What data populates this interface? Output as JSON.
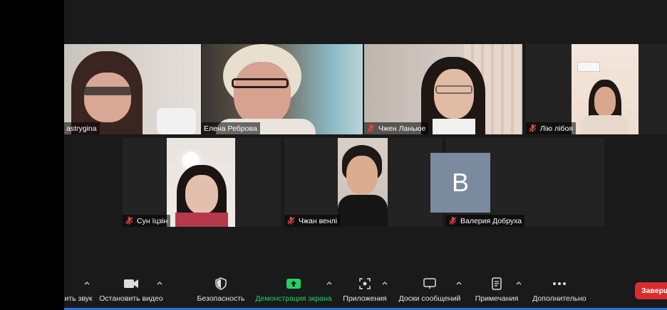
{
  "participants": [
    {
      "name": "astrygina",
      "muted": false
    },
    {
      "name": "Елена Реброва",
      "muted": false
    },
    {
      "name": "Чжен Ланьюе",
      "muted": true
    },
    {
      "name": "Лію  лібоя",
      "muted": true
    },
    {
      "name": "Сун їцзін",
      "muted": true
    },
    {
      "name": "Чжан венлі",
      "muted": true
    },
    {
      "name": "Валерия Добруха",
      "muted": true,
      "avatar_letter": "B"
    }
  ],
  "toolbar": {
    "mute_label": "ить звук",
    "video_label": "Остановить видео",
    "security_label": "Безопасность",
    "share_label": "Демонстрация экрана",
    "apps_label": "Приложения",
    "whiteboard_label": "Доски сообщений",
    "notes_label": "Примечания",
    "more_label": "Дополнительно",
    "end_label": "Заверш"
  },
  "colors": {
    "active_speaker": "#c4d85a",
    "share_green": "#23d160",
    "end_red": "#d92d2d",
    "mute_red": "#e0443e"
  }
}
